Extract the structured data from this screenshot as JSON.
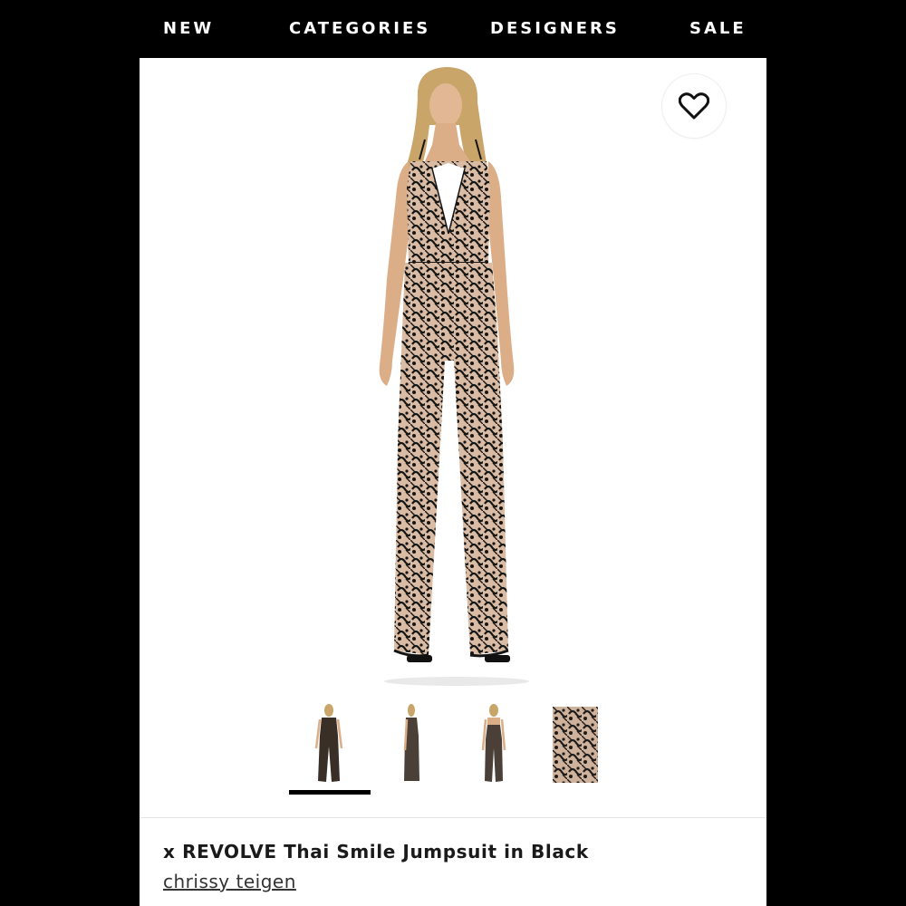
{
  "nav": {
    "items": [
      "NEW",
      "CATEGORIES",
      "DESIGNERS",
      "SALE"
    ]
  },
  "product": {
    "title": "x REVOLVE Thai Smile Jumpsuit in Black",
    "designer": "chrissy teigen",
    "wishlist_icon": "heart-outline-icon",
    "thumbnails_count": 4,
    "active_thumbnail": 1
  },
  "colors": {
    "nav_background": "#000000",
    "nav_text": "#ffffff",
    "page_background": "#ffffff",
    "lace": "#151515",
    "lining": "#d9bca3"
  }
}
